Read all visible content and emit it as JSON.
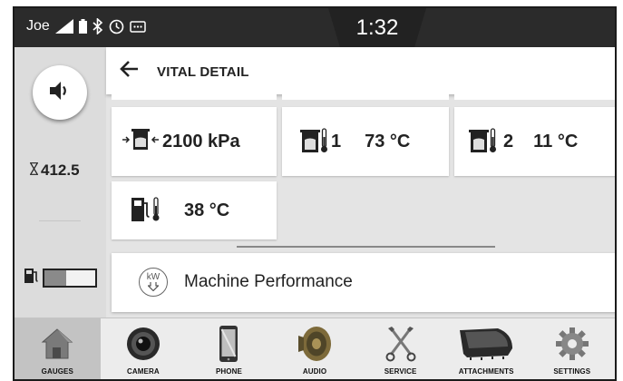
{
  "status_bar": {
    "user": "Joe",
    "time": "1:32"
  },
  "left_panel": {
    "hours_value": "412.5",
    "fuel_level": 0.42
  },
  "header": {
    "title": "VITAL DETAIL"
  },
  "vitals": [
    {
      "icon": "hydraulic-pressure-icon",
      "value": "2100 kPa"
    },
    {
      "icon": "hydraulic-temp-1-icon",
      "index": "1",
      "value": "73 °C"
    },
    {
      "icon": "hydraulic-temp-2-icon",
      "index": "2",
      "value": "11 °C"
    },
    {
      "icon": "fuel-temp-icon",
      "value": "38 °C"
    }
  ],
  "performance": {
    "icon_text": "kW",
    "label": "Machine Performance"
  },
  "nav": [
    {
      "label": "GAUGES",
      "icon": "home-icon",
      "active": true
    },
    {
      "label": "CAMERA",
      "icon": "camera-icon"
    },
    {
      "label": "PHONE",
      "icon": "phone-icon"
    },
    {
      "label": "AUDIO",
      "icon": "speaker-icon"
    },
    {
      "label": "SERVICE",
      "icon": "wrench-icon"
    },
    {
      "label": "ATTACHMENTS",
      "icon": "bucket-icon"
    },
    {
      "label": "SETTINGS",
      "icon": "gear-icon"
    }
  ]
}
